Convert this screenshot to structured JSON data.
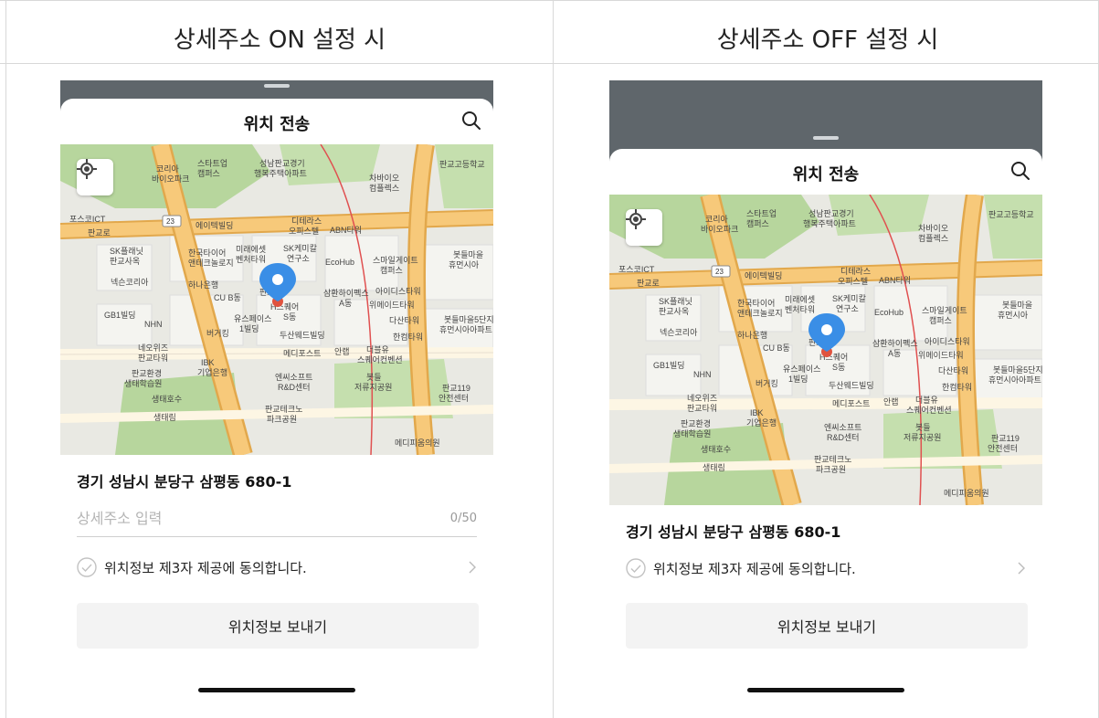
{
  "columns": [
    {
      "title": "상세주소 ON 설정 시"
    },
    {
      "title": "상세주소 OFF 설정 시"
    }
  ],
  "sheet": {
    "title": "위치 전송",
    "search_icon": "search-icon",
    "address": "경기 성남시 분당구 삼평동 680-1",
    "detail_placeholder": "상세주소 입력",
    "detail_value": "",
    "detail_counter": "0/50",
    "consent_label": "위치정보 제3자 제공에 동의합니다.",
    "send_label": "위치정보 보내기"
  },
  "map": {
    "labels": [
      "판교고등학교",
      "코리아 바이오파크",
      "스타트업 캠퍼스",
      "성남판교경기 행복주택아파트",
      "차바이오 컴플렉스",
      "포스코ICT",
      "에이텍빌딩",
      "디테라스 오피스텔",
      "ABN타워",
      "SK플래닛 판교사옥",
      "한국타이어 앤테크놀로지",
      "미래에셋 벤처타워",
      "SK케미칼 연구소",
      "EcoHub",
      "스마일게이트 캠퍼스",
      "봇들마을 휴먼시아",
      "넥슨코리아",
      "하나은행",
      "CU B동",
      "판교 피스",
      "삼환하이펙스 A동",
      "아이디스타워",
      "위메이드타워",
      "GB1빌딩",
      "NHN",
      "유스페이스 1빌딩",
      "H스퀘어 S동",
      "다산타워",
      "한컴타워",
      "버거킹",
      "두산웨드빌딩",
      "봇들마을5단지 휴먼시아아파트",
      "네오위즈 판교타워",
      "IBK 기업은행",
      "메디포스트",
      "안랩",
      "더블유 스퀘어컨벤션",
      "판교환경 생태학습원",
      "엔씨소프트 R&D센터",
      "봇들 저류지공원",
      "판교119 안전센터",
      "생태호수",
      "생태림",
      "판교테크노 파크공원",
      "메디피움의원",
      "판교로",
      "23"
    ],
    "colors": {
      "road_major": "#f7c97a",
      "road_outline": "#e2a84c",
      "park": "#b7d69d",
      "land": "#e9e9e3",
      "block": "#f4f4f0",
      "pin": "#3a8ee6",
      "route": "#e05050"
    }
  },
  "colors": {
    "dim": "#5f666b",
    "button_bg": "#f3f3f3",
    "divider": "#d8d8d8"
  }
}
